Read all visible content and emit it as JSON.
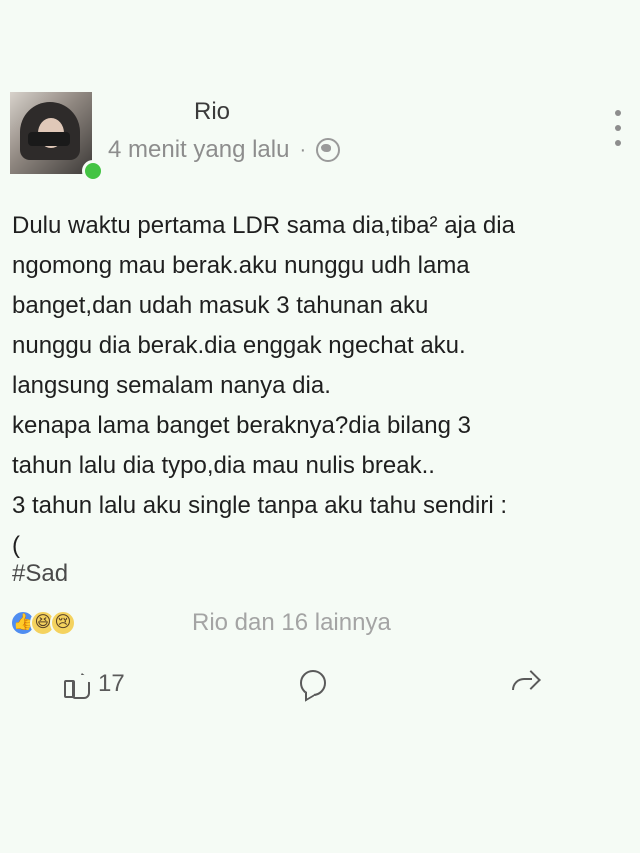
{
  "post": {
    "author": "Rio",
    "time": "4 menit yang lalu",
    "separator": "·",
    "content_lines": [
      "Dulu waktu pertama LDR sama dia,tiba² aja dia",
      "ngomong mau berak.aku nunggu udh lama",
      "banget,dan udah masuk 3 tahunan aku",
      "nunggu dia berak.dia enggak ngechat aku.",
      "langsung semalam nanya dia.",
      "kenapa lama banget beraknya?dia bilang 3",
      "tahun lalu dia typo,dia mau nulis break..",
      "3 tahun lalu aku single tanpa aku tahu sendiri :",
      "("
    ],
    "hashtag": "#Sad",
    "reaction_summary": "Rio dan 16 lainnya",
    "like_count": "17",
    "icons": {
      "avatar": "profile-photo",
      "privacy": "globe-icon",
      "more": "more-vertical-icon",
      "like": "thumb-up-icon",
      "comment": "comment-icon",
      "share": "share-icon"
    }
  }
}
